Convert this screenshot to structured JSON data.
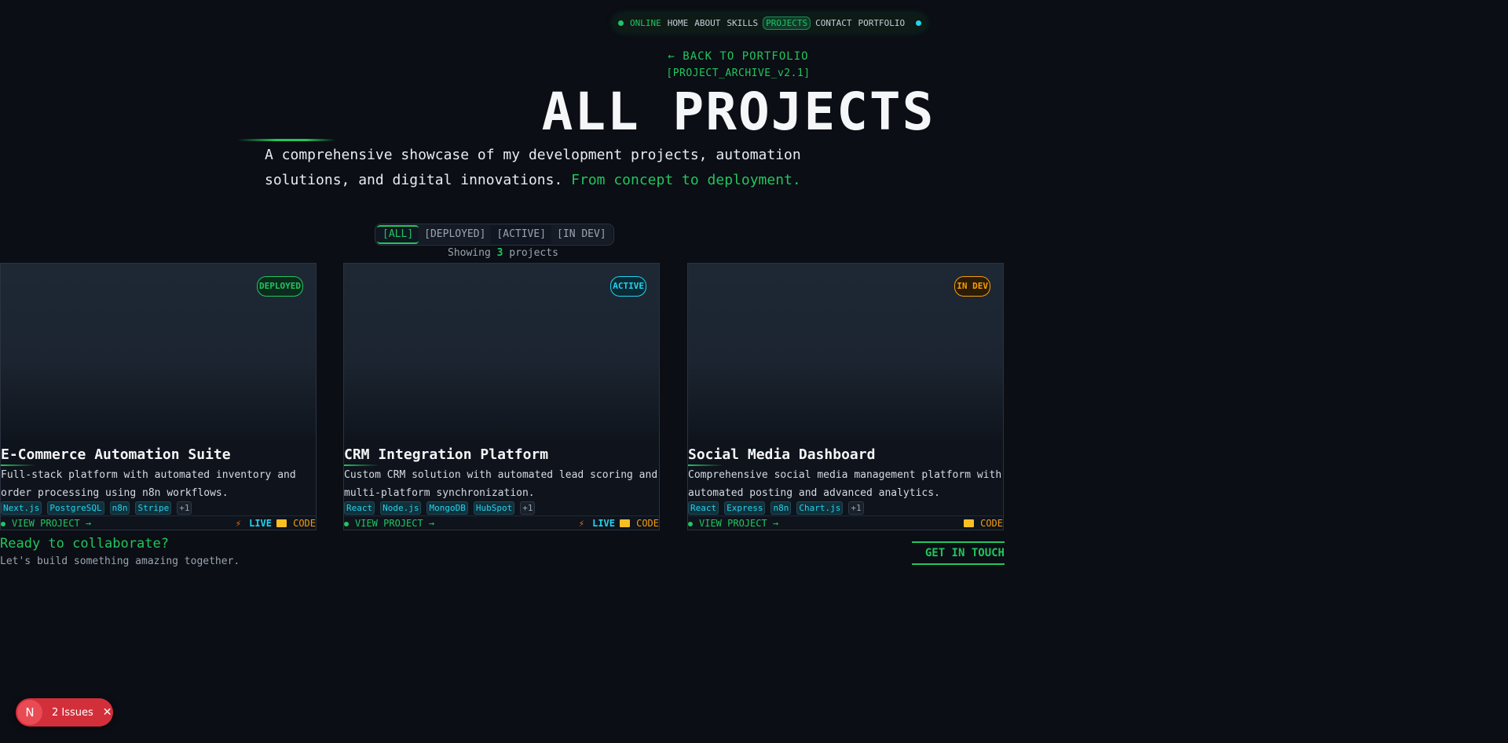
{
  "nav": {
    "status": "ONLINE",
    "items": [
      "HOME",
      "ABOUT",
      "SKILLS",
      "PROJECTS",
      "CONTACT",
      "PORTFOLIO"
    ],
    "active": "PROJECTS"
  },
  "back_link": "← BACK TO PORTFOLIO",
  "archive_tag": "[PROJECT_ARCHIVE_v2.1]",
  "title": "ALL PROJECTS",
  "description": {
    "text": "A comprehensive showcase of my development projects, automation solutions, and digital innovations.",
    "highlight": "From concept to deployment."
  },
  "filters": [
    "ALL",
    "DEPLOYED",
    "ACTIVE",
    "IN DEV"
  ],
  "active_filter": "ALL",
  "showing": {
    "prefix": "Showing",
    "count": "3",
    "suffix": "projects"
  },
  "projects": [
    {
      "title": "E-Commerce Automation Suite",
      "status": "DEPLOYED",
      "description": "Full-stack platform with automated inventory and order processing using n8n workflows.",
      "tags": [
        "Next.js",
        "PostgreSQL",
        "n8n",
        "Stripe",
        "+1"
      ],
      "view_label": "VIEW PROJECT →",
      "live_label": "LIVE",
      "code_label": "CODE"
    },
    {
      "title": "CRM Integration Platform",
      "status": "ACTIVE",
      "description": "Custom CRM solution with automated lead scoring and multi-platform synchronization.",
      "tags": [
        "React",
        "Node.js",
        "MongoDB",
        "HubSpot",
        "+1"
      ],
      "view_label": "VIEW PROJECT →",
      "live_label": "LIVE",
      "code_label": "CODE"
    },
    {
      "title": "Social Media Dashboard",
      "status": "IN DEV",
      "description": "Comprehensive social media management platform with automated posting and advanced analytics.",
      "tags": [
        "React",
        "Express",
        "n8n",
        "Chart.js",
        "+1"
      ],
      "view_label": "VIEW PROJECT →",
      "live_label": "",
      "code_label": "CODE"
    }
  ],
  "collaborate": {
    "title": "Ready to collaborate?",
    "subtitle": "Let's build something amazing together.",
    "button": "GET IN TOUCH"
  },
  "issues_badge": {
    "letter": "N",
    "label": "2 Issues"
  },
  "colors": {
    "accent_green": "#22c55e",
    "accent_cyan": "#22d3ee",
    "accent_orange": "#f59e0b",
    "background": "#0b0e14"
  }
}
